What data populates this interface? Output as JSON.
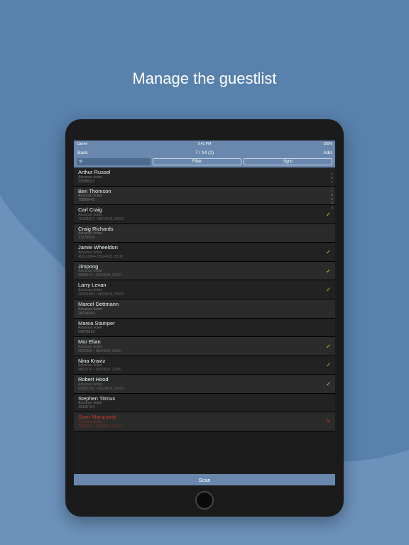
{
  "marketing": {
    "headline": "Manage the guestlist"
  },
  "statusbar": {
    "carrier": "Carrier",
    "time": "9:41 PM",
    "battery": "100%"
  },
  "navbar": {
    "back": "Back",
    "title": "7 / 14 (1)",
    "add": "Add"
  },
  "search": {
    "placeholder": "Q"
  },
  "segmented": {
    "filter": "Filter",
    "sync": "Sync"
  },
  "scan": {
    "label": "Scan"
  },
  "index_letters": [
    "A",
    "B",
    "C",
    "J",
    "L",
    "M",
    "N",
    "R",
    "S"
  ],
  "guests": [
    {
      "name": "Arthur Russel",
      "ticket": "Advance ticket",
      "code": "23098057",
      "checked": false,
      "error": false
    },
    {
      "name": "Ben Thomson",
      "ticket": "Advance ticket",
      "code": "79890949",
      "checked": false,
      "error": false
    },
    {
      "name": "Carl Craig",
      "ticket": "Advance ticket",
      "code": "76138307 • 05/24/18, 23:00",
      "checked": true,
      "error": false
    },
    {
      "name": "Craig Richards",
      "ticket": "Advance ticket",
      "code": "17270924",
      "checked": false,
      "error": false
    },
    {
      "name": "Jamie Wheeldon",
      "ticket": "Advance ticket",
      "code": "49111094 • 05/24/18, 23:00",
      "checked": true,
      "error": false
    },
    {
      "name": "Jimpong",
      "ticket": "Advance ticket",
      "code": "9855079 • 05/24/18, 23:00",
      "checked": true,
      "error": false
    },
    {
      "name": "Larry Levan",
      "ticket": "Advance ticket",
      "code": "26353480 • 05/24/18, 23:00",
      "checked": true,
      "error": false
    },
    {
      "name": "Marcel Dettmann",
      "ticket": "Advance ticket",
      "code": "28214949",
      "checked": false,
      "error": false
    },
    {
      "name": "Marea Stamper",
      "ticket": "Advance ticket",
      "code": "54579819",
      "checked": false,
      "error": false
    },
    {
      "name": "Mor Elian",
      "ticket": "Advance ticket",
      "code": "9620385 • 05/24/18, 23:00",
      "checked": true,
      "error": false
    },
    {
      "name": "Nina Kraviz",
      "ticket": "Advance ticket",
      "code": "9861916 • 05/24/18, 23:00",
      "checked": true,
      "error": false
    },
    {
      "name": "Robert Hood",
      "ticket": "Advance ticket",
      "code": "92955250 • 05/24/18, 23:00",
      "checked": true,
      "error": false
    },
    {
      "name": "Stephen Titmus",
      "ticket": "Advance ticket",
      "code": "43430704",
      "checked": false,
      "error": false
    },
    {
      "name": "Sven Marquardt",
      "ticket": "Advance ticket",
      "code": "2420806 • 05/29/18, 14:00",
      "checked": true,
      "error": true
    }
  ]
}
